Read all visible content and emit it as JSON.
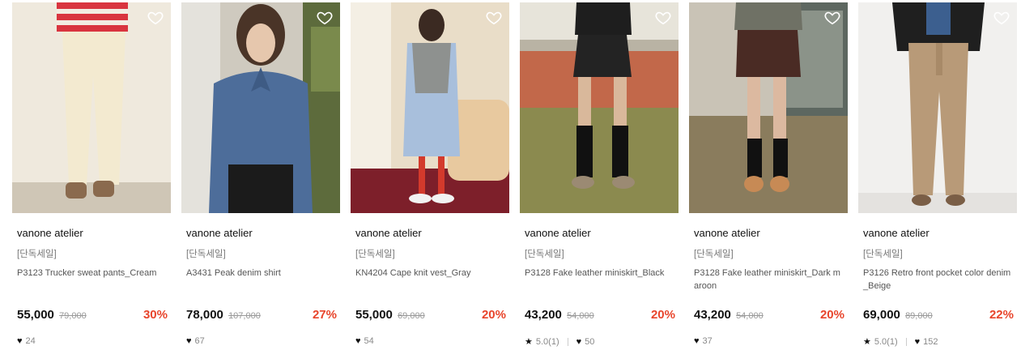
{
  "products": [
    {
      "brand": "vanone atelier",
      "tag": "[단독세일]",
      "name": "P3123 Trucker sweat pants_Cream",
      "price": "55,000",
      "original": "79,000",
      "discount": "30%",
      "rating": "",
      "likes": "24"
    },
    {
      "brand": "vanone atelier",
      "tag": "[단독세일]",
      "name": "A3431 Peak denim shirt",
      "price": "78,000",
      "original": "107,000",
      "discount": "27%",
      "rating": "",
      "likes": "67"
    },
    {
      "brand": "vanone atelier",
      "tag": "[단독세일]",
      "name": "KN4204 Cape knit vest_Gray",
      "price": "55,000",
      "original": "69,000",
      "discount": "20%",
      "rating": "",
      "likes": "54"
    },
    {
      "brand": "vanone atelier",
      "tag": "[단독세일]",
      "name": "P3128 Fake leather miniskirt_Black",
      "price": "43,200",
      "original": "54,000",
      "discount": "20%",
      "rating": "5.0(1)",
      "likes": "50"
    },
    {
      "brand": "vanone atelier",
      "tag": "[단독세일]",
      "name": "P3128 Fake leather miniskirt_Dark maroon",
      "price": "43,200",
      "original": "54,000",
      "discount": "20%",
      "rating": "",
      "likes": "37"
    },
    {
      "brand": "vanone atelier",
      "tag": "[단독세일]",
      "name": "P3126 Retro front pocket color denim_Beige",
      "price": "69,000",
      "original": "89,000",
      "discount": "22%",
      "rating": "5.0(1)",
      "likes": "152"
    }
  ]
}
